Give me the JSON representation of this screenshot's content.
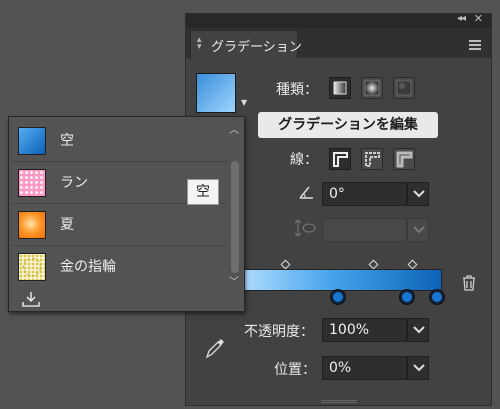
{
  "panel": {
    "tab_title": "グラデーション",
    "type_label": "種類：",
    "edit_button": "グラデーションを編集",
    "stroke_label": "線：",
    "angle_value": "0°",
    "opacity_label": "不透明度：",
    "opacity_value": "100%",
    "position_label": "位置：",
    "position_value": "0%"
  },
  "presets": {
    "items": [
      {
        "label": "空"
      },
      {
        "label": "ラン"
      },
      {
        "label": "夏"
      },
      {
        "label": "金の指輪"
      }
    ],
    "tooltip": "空"
  },
  "icons": {
    "collapse": "double-chevron-left-icon",
    "close": "close-icon",
    "menu": "hamburger-menu-icon",
    "angle": "angle-icon",
    "aspect": "aspect-ratio-icon",
    "eyedropper": "eyedropper-icon",
    "trash": "trash-icon",
    "import": "import-icon"
  },
  "colors": {
    "gradient_start": "#b8e1ff",
    "gradient_end": "#0d63b8",
    "panel_bg": "#424242"
  }
}
